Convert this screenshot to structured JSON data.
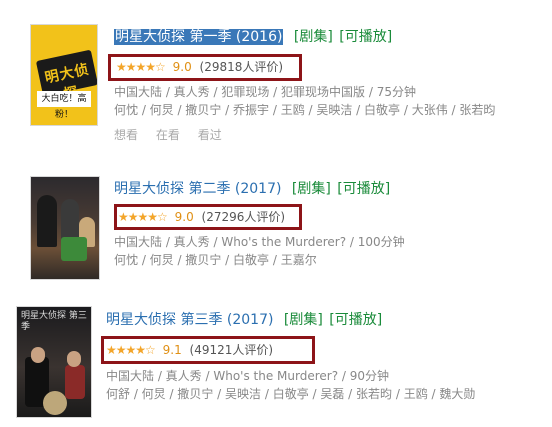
{
  "results": [
    {
      "poster": {
        "text": "明大侦探",
        "foot": "大白吃！高粉！"
      },
      "title": "明星大侦探 第一季 (2016)",
      "tags": [
        "[剧集]",
        "[可播放]"
      ],
      "stars": "★★★★☆",
      "score": "9.0",
      "count": "(29818人评价)",
      "meta": "中国大陆 / 真人秀 / 犯罪现场 / 犯罪现场中国版 / 75分钟",
      "cast": "何忱 / 何炅 / 撒贝宁 / 乔振宇 / 王鸥 / 吴映洁 / 白敬亭 / 大张伟 / 张若昀",
      "actions": [
        "想看",
        "在看",
        "看过"
      ]
    },
    {
      "title": "明星大侦探 第二季 (2017)",
      "tags": [
        "[剧集]",
        "[可播放]"
      ],
      "stars": "★★★★☆",
      "score": "9.0",
      "count": "(27296人评价)",
      "meta": "中国大陆 / 真人秀 / Who's the Murderer? / 100分钟",
      "cast": "何忱 / 何炅 / 撒贝宁 / 白敬亭 / 王嘉尔"
    },
    {
      "poster": {
        "text": "明星大侦探 第三季"
      },
      "title": "明星大侦探 第三季 (2017)",
      "tags": [
        "[剧集]",
        "[可播放]"
      ],
      "stars": "★★★★☆",
      "score": "9.1",
      "count": "(49121人评价)",
      "meta": "中国大陆 / 真人秀 / Who's the Murderer? / 90分钟",
      "cast": "何舒 / 何炅 / 撒贝宁 / 吴映洁 / 白敬亭 / 吴磊 / 张若昀 / 王鸥 / 魏大勋"
    }
  ]
}
